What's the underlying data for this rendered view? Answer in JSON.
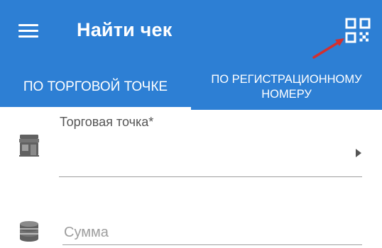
{
  "header": {
    "title": "Найти чек",
    "menu_icon": "menu-icon",
    "qr_icon": "qr-code-icon",
    "accent_color": "#2d7fd4",
    "annotation_arrow_color": "#d32f2f"
  },
  "tabs": [
    {
      "label": "ПО ТОРГОВОЙ ТОЧКЕ",
      "selected": true
    },
    {
      "label": "ПО РЕГИСТРАЦИОННОМУ НОМЕРУ",
      "selected": false
    }
  ],
  "form": {
    "store_field": {
      "label": "Торговая точка*",
      "value": "",
      "icon": "store-icon"
    },
    "sum_field": {
      "placeholder": "Сумма",
      "value": "",
      "icon": "coins-icon"
    }
  }
}
